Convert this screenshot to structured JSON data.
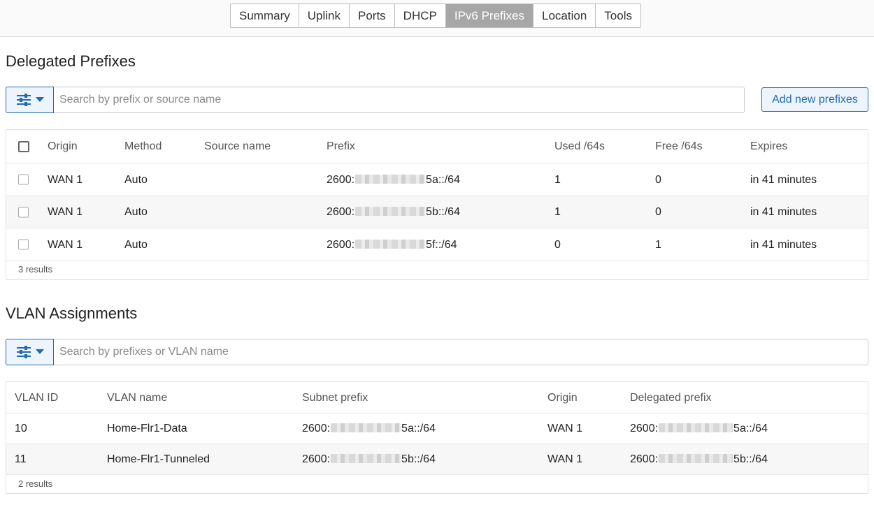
{
  "tabs": [
    {
      "label": "Summary",
      "active": false
    },
    {
      "label": "Uplink",
      "active": false
    },
    {
      "label": "Ports",
      "active": false
    },
    {
      "label": "DHCP",
      "active": false
    },
    {
      "label": "IPv6 Prefixes",
      "active": true
    },
    {
      "label": "Location",
      "active": false
    },
    {
      "label": "Tools",
      "active": false
    }
  ],
  "delegated": {
    "title": "Delegated Prefixes",
    "search_placeholder": "Search by prefix or source name",
    "add_label": "Add new prefixes",
    "columns": [
      "Origin",
      "Method",
      "Source name",
      "Prefix",
      "Used /64s",
      "Free /64s",
      "Expires"
    ],
    "rows": [
      {
        "origin": "WAN 1",
        "method": "Auto",
        "source": "",
        "prefix_start": "2600:",
        "prefix_end": "5a::/64",
        "used": "1",
        "free": "0",
        "expires": "in 41 minutes"
      },
      {
        "origin": "WAN 1",
        "method": "Auto",
        "source": "",
        "prefix_start": "2600:",
        "prefix_end": "5b::/64",
        "used": "1",
        "free": "0",
        "expires": "in 41 minutes"
      },
      {
        "origin": "WAN 1",
        "method": "Auto",
        "source": "",
        "prefix_start": "2600:",
        "prefix_end": "5f::/64",
        "used": "0",
        "free": "1",
        "expires": "in 41 minutes"
      }
    ],
    "results": "3 results"
  },
  "vlan": {
    "title": "VLAN Assignments",
    "search_placeholder": "Search by prefixes or VLAN name",
    "columns": [
      "VLAN ID",
      "VLAN name",
      "Subnet prefix",
      "Origin",
      "Delegated prefix"
    ],
    "rows": [
      {
        "id": "10",
        "name": "Home-Flr1-Data",
        "subnet_start": "2600:",
        "subnet_end": "5a::/64",
        "origin": "WAN 1",
        "deleg_start": "2600:",
        "deleg_end": "5a::/64"
      },
      {
        "id": "11",
        "name": "Home-Flr1-Tunneled",
        "subnet_start": "2600:",
        "subnet_end": "5b::/64",
        "origin": "WAN 1",
        "deleg_start": "2600:",
        "deleg_end": "5b::/64"
      }
    ],
    "results": "2 results"
  },
  "icons": {
    "filter": "sliders-icon",
    "dropdown": "caret-down-icon"
  },
  "colors": {
    "accent": "#1f6bb5",
    "active_tab": "#a6a6a6"
  }
}
